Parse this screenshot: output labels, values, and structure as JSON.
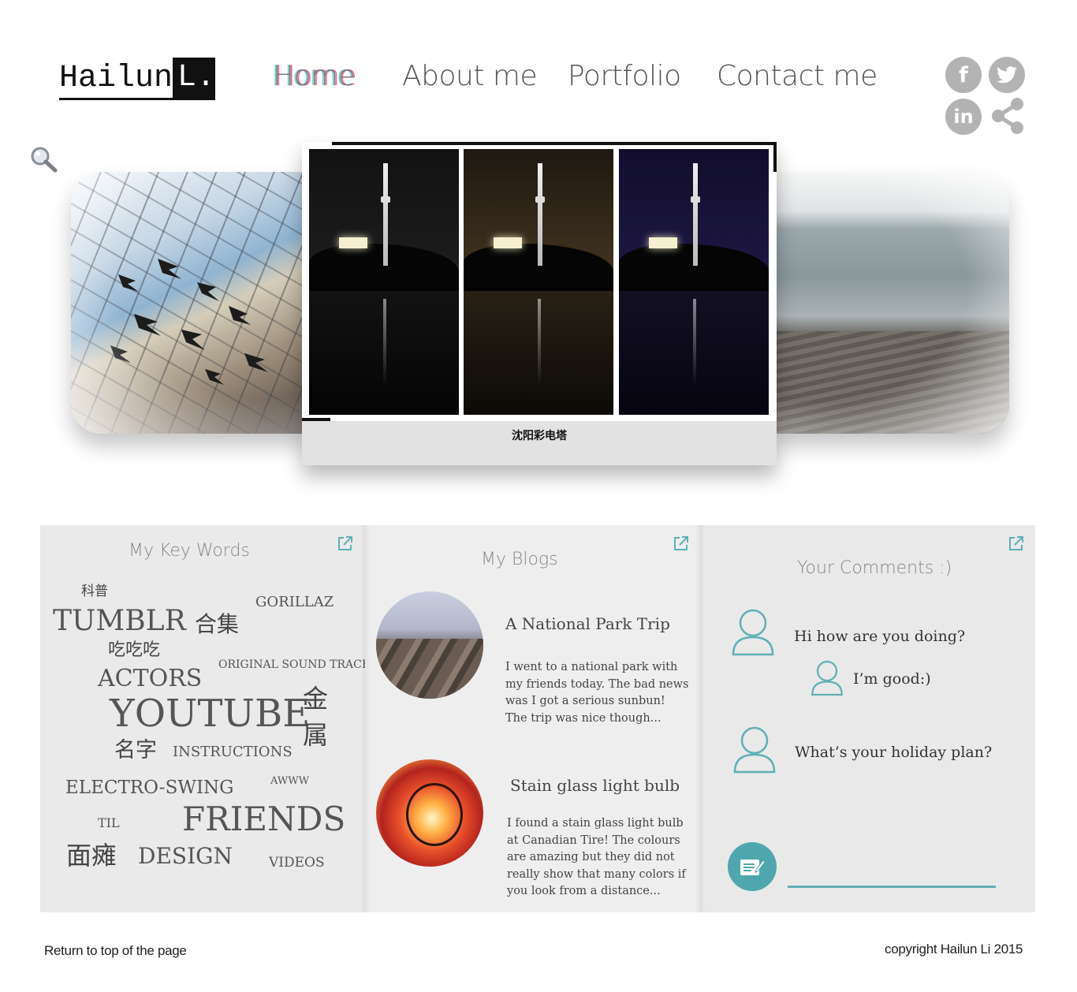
{
  "logo": {
    "first": "Hailun",
    "last": "L."
  },
  "nav": {
    "home": "Home",
    "about": "About me",
    "portfolio": "Portfolio",
    "contact": "Contact me",
    "active": "Home"
  },
  "social": {
    "facebook_glyph": "f",
    "linkedin_glyph": "in",
    "icons": [
      "facebook-icon",
      "twitter-icon",
      "linkedin-icon",
      "share-icon"
    ]
  },
  "carousel": {
    "caption": "沈阳彩电塔"
  },
  "keywords": {
    "title": "My Key Words",
    "words": [
      "科普",
      "TUMBLR",
      "合集",
      "GORILLAZ",
      "吃吃吃",
      "ORIGINAL SOUND TRACK",
      "ACTORS",
      "YOUTUBE",
      "金",
      "属",
      "名字",
      "INSTRUCTIONS",
      "ELECTRO-SWING",
      "AWWW",
      "TIL",
      "FRIENDS",
      "面瘫",
      "DESIGN",
      "VIDEOS"
    ]
  },
  "blogs": {
    "title": "My Blogs",
    "posts": [
      {
        "title": "A National Park Trip",
        "lines": [
          "I went to a national park with",
          "my friends today. The bad news",
          "was I got a serious sunbun!",
          "The trip was nice though..."
        ]
      },
      {
        "title": "Stain glass light bulb",
        "lines": [
          "I found a stain glass light bulb",
          "at Canadian Tire! The colours",
          "are amazing but they did not",
          "really show that many colors if",
          "you look from a distance..."
        ]
      }
    ]
  },
  "comments": {
    "title": "Your Comments :)",
    "items": [
      "Hi how are you doing?",
      "I’m good:)",
      "What’s your holiday plan?"
    ],
    "input_value": ""
  },
  "footer": {
    "return_link": "Return to top of the page",
    "copyright": "copyright Hailun Li 2015"
  },
  "colors": {
    "accent": "#4fa7ad",
    "social_gray": "#b3b3b3",
    "text": "#444444"
  }
}
